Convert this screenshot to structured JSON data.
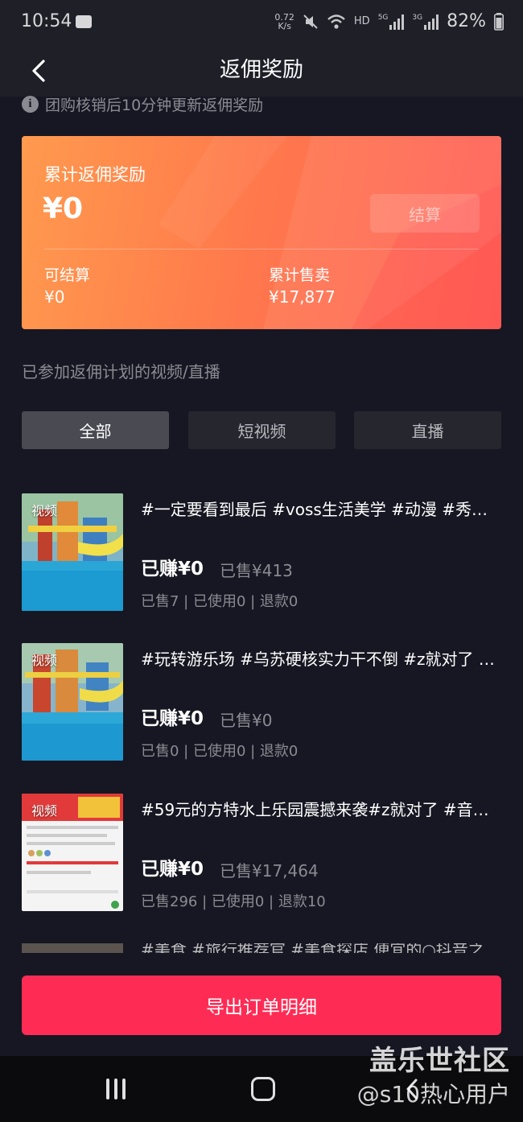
{
  "status_bar": {
    "time": "10:54",
    "net_speed": "0.72\nK/s",
    "hd_label": "HD",
    "sig1_label": "5G",
    "sig2_label": "3G",
    "battery": "82%",
    "icons": [
      "message-icon",
      "mute-icon",
      "wifi-icon",
      "signal-icon",
      "battery-icon"
    ]
  },
  "header": {
    "title": "返佣奖励",
    "back_icon": "chevron-left-icon"
  },
  "notice": {
    "icon": "info-icon",
    "icon_glyph": "i",
    "text": "团购核销后10分钟更新返佣奖励"
  },
  "reward_card": {
    "label": "累计返佣奖励",
    "total": "¥0",
    "settle_button": "结算",
    "settleable_label": "可结算",
    "settleable_value": "¥0",
    "sales_label": "累计售卖",
    "sales_value": "¥17,877",
    "gradient_colors": [
      "#ff9a4e",
      "#ff7a4c",
      "#ff5f57"
    ]
  },
  "section_title": "已参加返佣计划的视频/直播",
  "tabs": [
    {
      "label": "全部",
      "active": true
    },
    {
      "label": "短视频",
      "active": false
    },
    {
      "label": "直播",
      "active": false
    }
  ],
  "items": [
    {
      "badge": "视频",
      "title": "#一定要看到最后 #voss生活美学 #动漫 #秀出…",
      "earned": "已赚¥0",
      "sold_amount": "已售¥413",
      "stats": "已售7 | 已使用0 | 退款0"
    },
    {
      "badge": "视频",
      "title": "#玩转游乐场 #乌苏硬核实力干不倒 #z就对了 …",
      "earned": "已赚¥0",
      "sold_amount": "已售¥0",
      "stats": "已售0 | 已使用0 | 退款0"
    },
    {
      "badge": "视频",
      "title": "#59元的方特水上乐园震撼来袭#z就对了 #音…",
      "earned": "已赚¥0",
      "sold_amount": "已售¥17,464",
      "stats": "已售296 | 已使用0 | 退款10"
    }
  ],
  "partial_item": {
    "title": "#美食 #旅行推荐官 #美食探店 便宜的○抖音之"
  },
  "export_button": "导出订单明细",
  "system_nav": {
    "recent_icon": "recent-apps-icon",
    "home_icon": "home-icon",
    "back_icon": "back-icon"
  },
  "watermark": {
    "line1": "盖乐世社区",
    "line2": "@s10热心用户"
  },
  "accent_color": "#fe2c55"
}
